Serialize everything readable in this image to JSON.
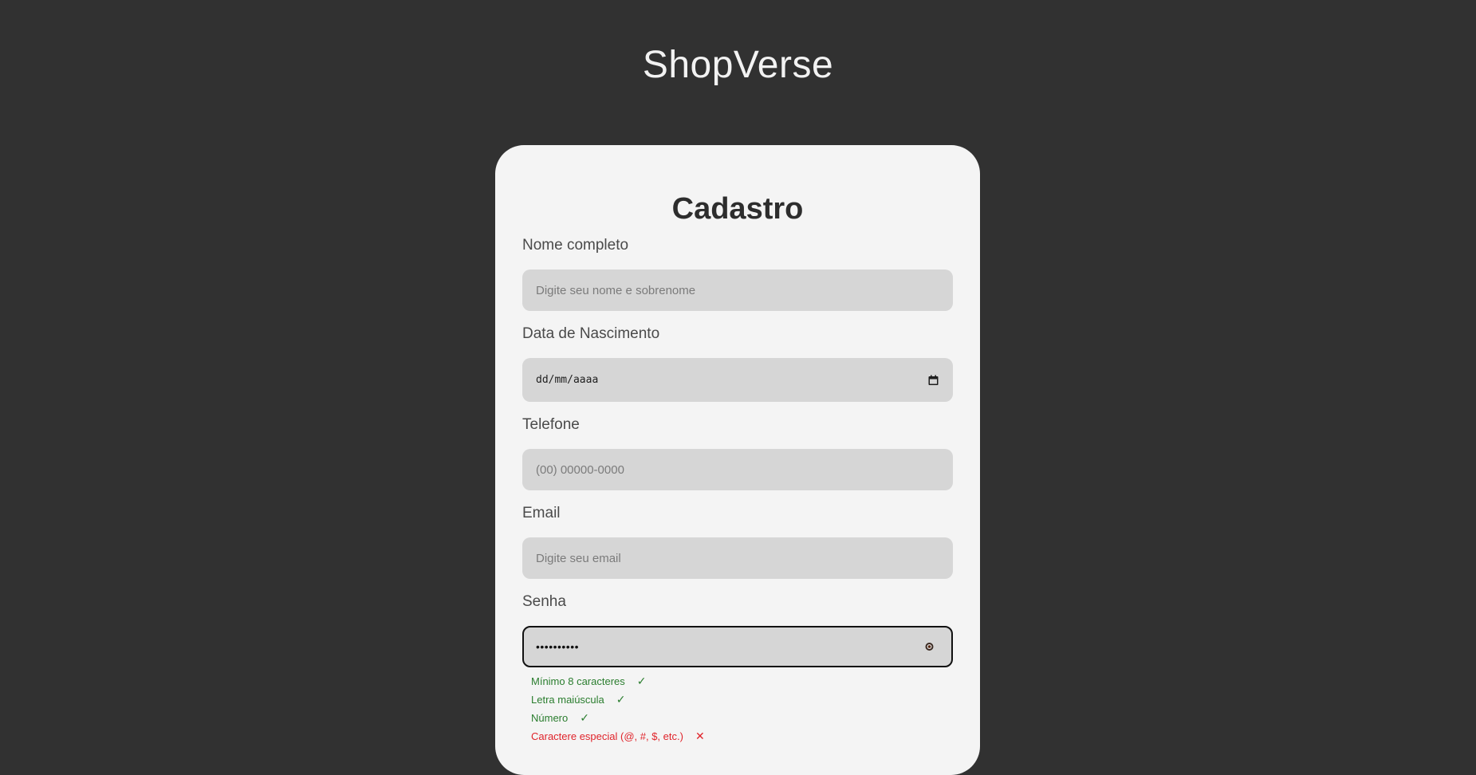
{
  "brand": "ShopVerse",
  "form": {
    "title": "Cadastro",
    "fields": {
      "name": {
        "label": "Nome completo",
        "placeholder": "Digite seu nome e sobrenome"
      },
      "birth": {
        "label": "Data de Nascimento",
        "placeholder": "dd/mm/aaaa"
      },
      "phone": {
        "label": "Telefone",
        "placeholder": "(00) 00000-0000"
      },
      "email": {
        "label": "Email",
        "placeholder": "Digite seu email"
      },
      "password": {
        "label": "Senha",
        "value": "••••••••••"
      }
    },
    "requirements": [
      {
        "text": "Mínimo 8 caracteres",
        "mark": "✓",
        "status": "ok"
      },
      {
        "text": "Letra maiúscula",
        "mark": "✓",
        "status": "ok"
      },
      {
        "text": "Número",
        "mark": "✓",
        "status": "ok"
      },
      {
        "text": "Caractere especial (@, #, $, etc.)",
        "mark": "✕",
        "status": "bad"
      }
    ]
  },
  "colors": {
    "background": "#313131",
    "card": "#f4f4f4",
    "input": "#d6d6d6",
    "ok": "#2a7d2e",
    "error": "#e0242b"
  },
  "icons": {
    "date": "calendar-icon",
    "password": "eye-icon"
  }
}
